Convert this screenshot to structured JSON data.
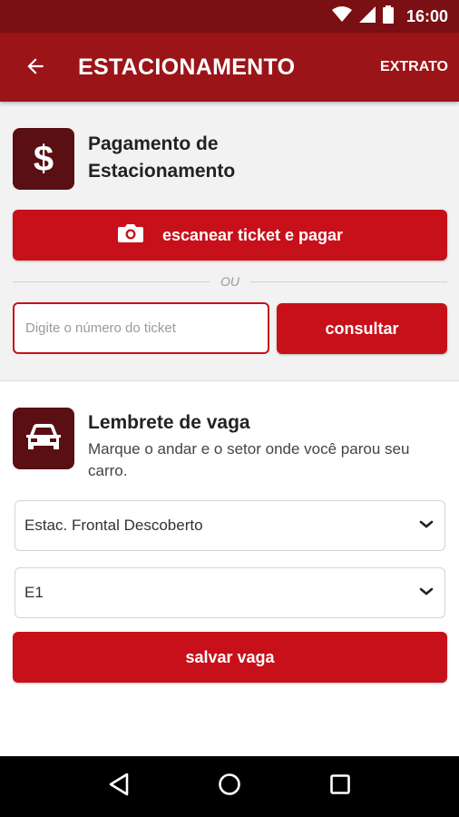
{
  "status_bar": {
    "time": "16:00",
    "icons": [
      "wifi-icon",
      "signal-icon",
      "battery-icon"
    ]
  },
  "app_bar": {
    "title": "ESTACIONAMENTO",
    "action_label": "EXTRATO",
    "back_icon": "arrow-back-icon"
  },
  "payment": {
    "icon": "dollar-icon",
    "title": "Pagamento de Estacionamento",
    "scan_button_label": "escanear ticket e pagar",
    "scan_icon": "camera-icon",
    "or_label": "OU",
    "ticket_placeholder": "Digite o número do ticket",
    "ticket_value": "",
    "consult_button_label": "consultar"
  },
  "reminder": {
    "icon": "car-icon",
    "title": "Lembrete de vaga",
    "subtitle": "Marque o andar e o setor onde você parou seu carro.",
    "parking_select": "Estac. Frontal Descoberto",
    "sector_select": "E1",
    "save_button_label": "salvar vaga"
  },
  "colors": {
    "status_bar": "#7a0f14",
    "app_bar": "#9b1418",
    "accent": "#c8101a",
    "icon_tile": "#5a0f12"
  }
}
